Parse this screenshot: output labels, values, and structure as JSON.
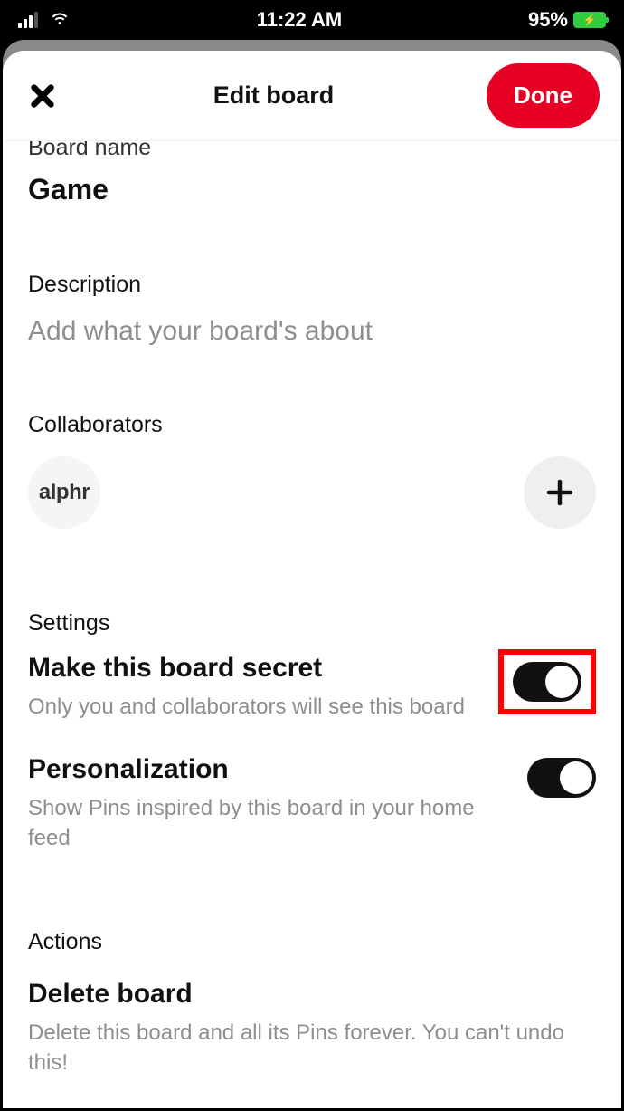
{
  "status": {
    "time": "11:22 AM",
    "battery": "95%"
  },
  "header": {
    "title": "Edit board",
    "done": "Done"
  },
  "board_name": {
    "label": "Board name",
    "value": "Game"
  },
  "description": {
    "label": "Description",
    "placeholder": "Add what your board's about"
  },
  "collaborators": {
    "label": "Collaborators",
    "avatar_text": "alphr"
  },
  "settings": {
    "label": "Settings",
    "secret": {
      "title": "Make this board secret",
      "sub": "Only you and collaborators will see this board"
    },
    "personalization": {
      "title": "Personalization",
      "sub": "Show Pins inspired by this board in your home feed"
    }
  },
  "actions": {
    "label": "Actions",
    "delete": {
      "title": "Delete board",
      "sub": "Delete this board and all its Pins forever. You can't undo this!"
    }
  }
}
